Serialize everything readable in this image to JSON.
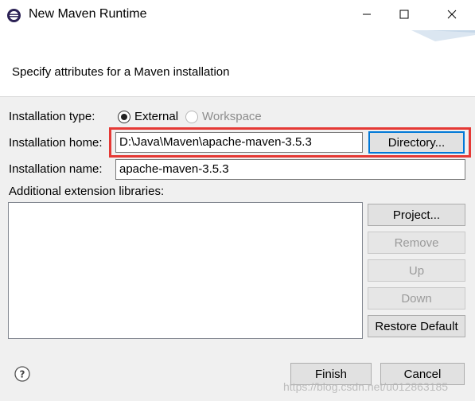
{
  "window": {
    "title": "New Maven Runtime",
    "icon": "eclipse-icon",
    "controls": [
      "minimize-icon",
      "maximize-icon",
      "close-icon"
    ]
  },
  "banner": {
    "subtitle": "Specify attributes for a Maven installation"
  },
  "form": {
    "installation_type_label": "Installation type:",
    "type_options": [
      {
        "label": "External",
        "selected": true,
        "enabled": true
      },
      {
        "label": "Workspace",
        "selected": false,
        "enabled": false
      }
    ],
    "home_label": "Installation home:",
    "home_value": "D:\\Java\\Maven\\apache-maven-3.5.3",
    "directory_button": "Directory...",
    "name_label": "Installation name:",
    "name_value": "apache-maven-3.5.3",
    "ext_libs_label": "Additional extension libraries:",
    "libs_buttons": {
      "project": "Project...",
      "remove": "Remove",
      "up": "Up",
      "down": "Down",
      "restore": "Restore Default"
    }
  },
  "footer": {
    "help_icon": "help-icon",
    "finish": "Finish",
    "cancel": "Cancel"
  },
  "watermark": "https://blog.csdn.net/u012863185",
  "colors": {
    "highlight": "#e53935",
    "focus": "#0078d7"
  }
}
